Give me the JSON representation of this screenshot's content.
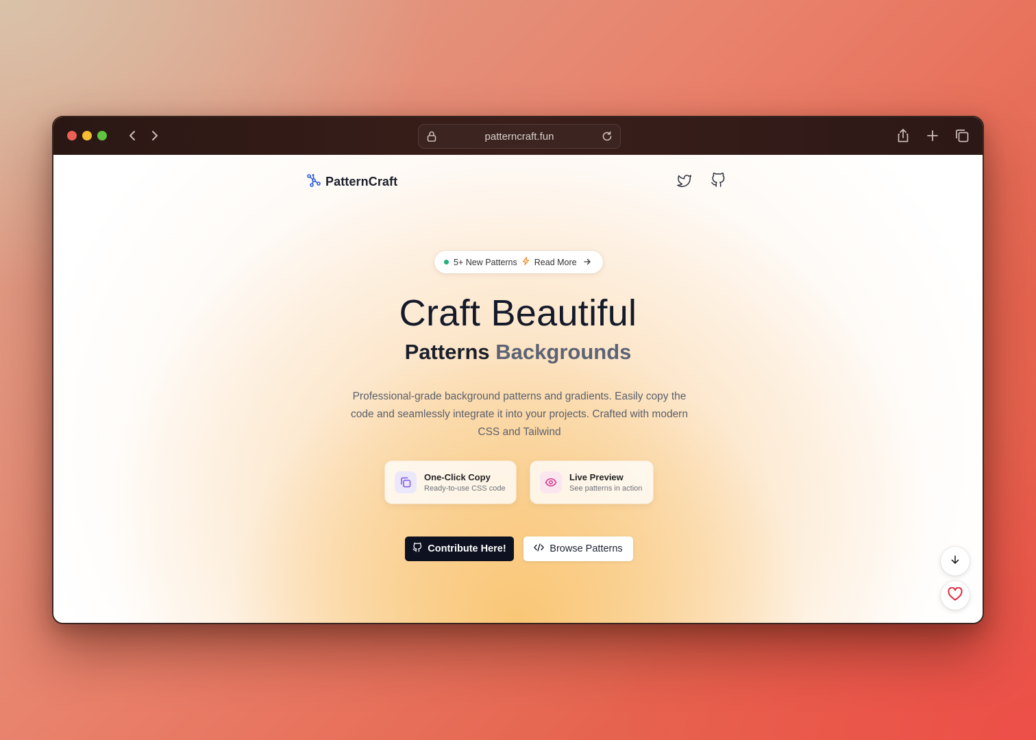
{
  "browser": {
    "url": "patterncraft.fun"
  },
  "site": {
    "logo_text": "PatternCraft",
    "header_icons": [
      "twitter-icon",
      "github-icon"
    ]
  },
  "badge": {
    "new_text": "5+ New Patterns",
    "link_text": "Read More"
  },
  "hero": {
    "title": "Craft Beautiful",
    "subtitle_main": "Patterns",
    "subtitle_alt": "Backgrounds",
    "description": "Professional-grade background patterns and gradients. Easily copy the code and seamlessly integrate it into your projects. Crafted with modern CSS and Tailwind"
  },
  "features": [
    {
      "title": "One-Click Copy",
      "subtitle": "Ready-to-use CSS code",
      "icon": "copy-icon"
    },
    {
      "title": "Live Preview",
      "subtitle": "See patterns in action",
      "icon": "eye-icon"
    }
  ],
  "buttons": {
    "contribute": "Contribute Here!",
    "browse": "Browse Patterns"
  },
  "colors": {
    "accent_green": "#22b07d",
    "button_dark": "#0e1120",
    "heart_red": "#e0283a"
  }
}
